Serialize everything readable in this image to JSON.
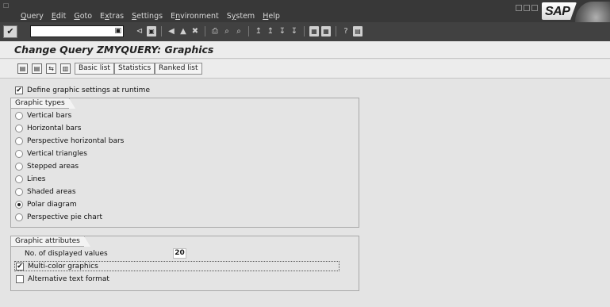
{
  "menu": {
    "items": [
      {
        "pre": "",
        "u": "Q",
        "post": "uery"
      },
      {
        "pre": "",
        "u": "E",
        "post": "dit"
      },
      {
        "pre": "",
        "u": "G",
        "post": "oto"
      },
      {
        "pre": "E",
        "u": "x",
        "post": "tras"
      },
      {
        "pre": "",
        "u": "S",
        "post": "ettings"
      },
      {
        "pre": "E",
        "u": "n",
        "post": "vironment"
      },
      {
        "pre": "S",
        "u": "y",
        "post": "stem"
      },
      {
        "pre": "",
        "u": "H",
        "post": "elp"
      }
    ],
    "logo": "SAP"
  },
  "toolbar": {
    "command_value": "",
    "ok_glyph": "✔",
    "icons": [
      "⊲",
      "▣",
      "|",
      "◀",
      "▲",
      "✖",
      "|",
      "⎙",
      "⌕",
      "⌕",
      "|",
      "↥",
      "↥",
      "↧",
      "↧",
      "|",
      "▦",
      "▦",
      "|",
      "?",
      "▤"
    ]
  },
  "title": "Change Query ZMYQUERY: Graphics",
  "appbar": {
    "icons": [
      "▤",
      "▤",
      "⇆",
      "▥"
    ],
    "buttons": [
      "Basic list",
      "Statistics",
      "Ranked list"
    ]
  },
  "runtime": {
    "label": "Define graphic settings at runtime",
    "checked": true
  },
  "graphic_types": {
    "title": "Graphic types",
    "options": [
      {
        "label": "Vertical bars",
        "selected": false
      },
      {
        "label": "Horizontal bars",
        "selected": false
      },
      {
        "label": "Perspective horizontal bars",
        "selected": false
      },
      {
        "label": "Vertical triangles",
        "selected": false
      },
      {
        "label": "Stepped areas",
        "selected": false
      },
      {
        "label": "Lines",
        "selected": false
      },
      {
        "label": "Shaded areas",
        "selected": false
      },
      {
        "label": "Polar diagram",
        "selected": true
      },
      {
        "label": "Perspective pie chart",
        "selected": false
      }
    ]
  },
  "graphic_attributes": {
    "title": "Graphic attributes",
    "displayed_values_label": "No. of displayed values",
    "displayed_values": "20",
    "multicolor_label": "Multi-color graphics",
    "multicolor_checked": true,
    "alt_text_label": "Alternative text format",
    "alt_text_checked": false
  }
}
